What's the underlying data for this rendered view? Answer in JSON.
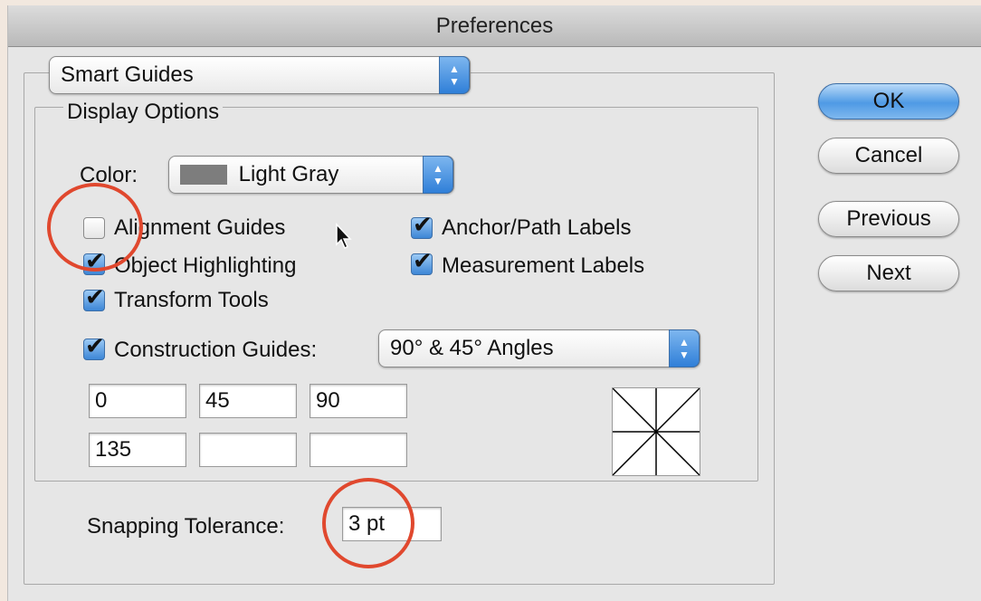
{
  "window": {
    "title": "Preferences"
  },
  "section_popup": {
    "value": "Smart Guides"
  },
  "display_options": {
    "legend": "Display Options",
    "color_label": "Color:",
    "color_value": "Light Gray",
    "color_swatch": "#7d7d7d",
    "checkboxes": [
      {
        "label": "Alignment Guides",
        "checked": false
      },
      {
        "label": "Object Highlighting",
        "checked": true
      },
      {
        "label": "Transform Tools",
        "checked": true
      },
      {
        "label": "Anchor/Path Labels",
        "checked": true
      },
      {
        "label": "Measurement Labels",
        "checked": true
      }
    ],
    "construction_guides": {
      "label": "Construction Guides:",
      "checked": true,
      "popup_value": "90° & 45° Angles",
      "angles": [
        "0",
        "45",
        "90",
        "135",
        "",
        ""
      ]
    }
  },
  "snapping": {
    "label": "Snapping Tolerance:",
    "value": "3 pt"
  },
  "buttons": {
    "ok": "OK",
    "cancel": "Cancel",
    "previous": "Previous",
    "next": "Next"
  },
  "icons": {
    "checkmark": "checkmark-icon",
    "popup_arrows": "updown-arrows-icon",
    "cursor": "mouse-pointer-icon"
  },
  "colors": {
    "annotation": "#e0482e",
    "accent": "#3d86d6"
  }
}
